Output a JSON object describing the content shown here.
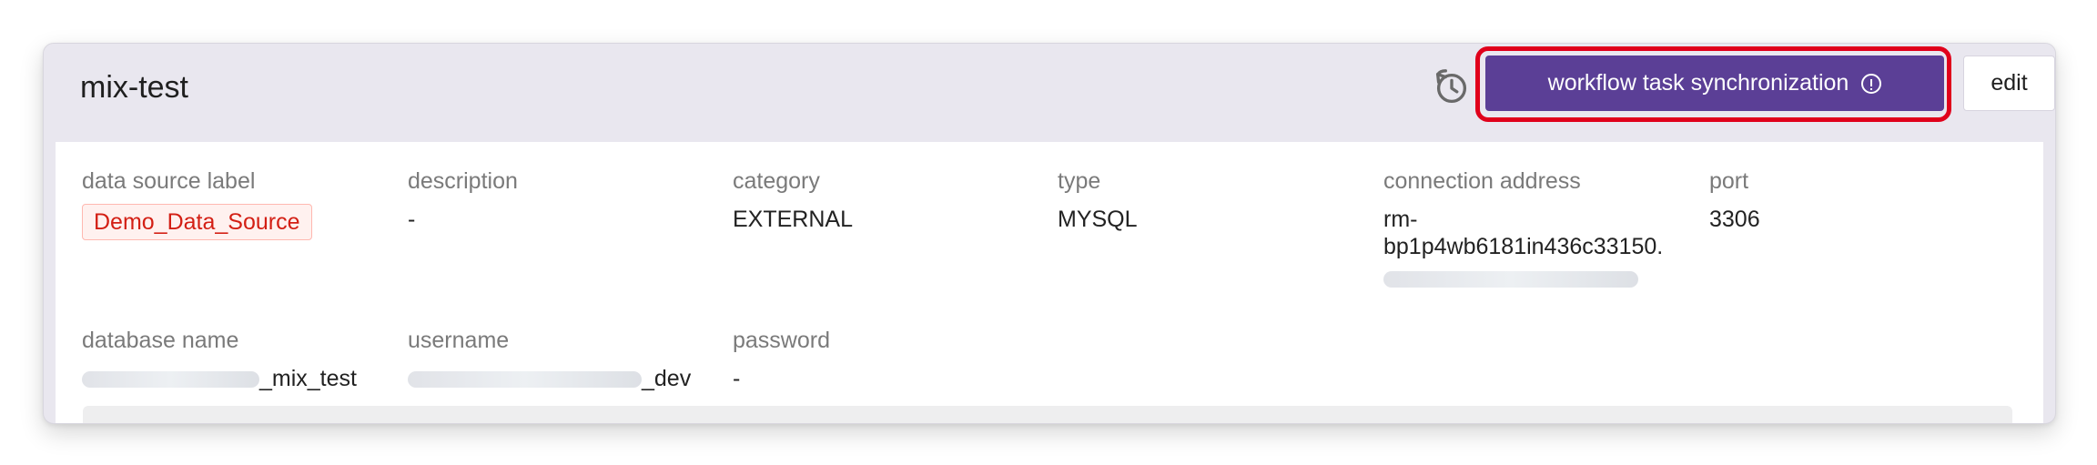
{
  "header": {
    "title": "mix-test",
    "sync_button_label": "workflow task synchronization",
    "edit_button_label": "edit"
  },
  "fields": {
    "data_source_label": {
      "label": "data source label",
      "value": "Demo_Data_Source"
    },
    "description": {
      "label": "description",
      "value": "-"
    },
    "category": {
      "label": "category",
      "value": "EXTERNAL"
    },
    "type": {
      "label": "type",
      "value": "MYSQL"
    },
    "connection_address": {
      "label": "connection address",
      "value": "rm-\nbp1p4wb6181in436c33150."
    },
    "port": {
      "label": "port",
      "value": "3306"
    },
    "database_name": {
      "label": "database name",
      "suffix": "_mix_test"
    },
    "username": {
      "label": "username",
      "suffix": "_dev"
    },
    "password": {
      "label": "password",
      "value": "-"
    }
  },
  "icons": {
    "history": "history-icon",
    "info": "info-icon"
  },
  "colors": {
    "primary_button": "#5b3f96",
    "highlight": "#e0001b",
    "tag_text": "#d31f14",
    "tag_background": "#fff1ef"
  }
}
